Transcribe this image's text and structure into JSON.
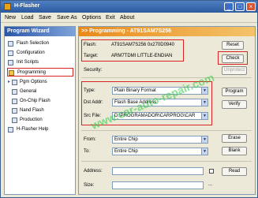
{
  "app": {
    "title": "H-Flasher"
  },
  "window_controls": {
    "minimize": "_",
    "maximize": "□",
    "close": "×"
  },
  "menu": [
    "New",
    "Load",
    "Save",
    "Save As",
    "Options",
    "Exit",
    "About"
  ],
  "sidebar": {
    "title": "Program Wizard",
    "items": [
      {
        "label": "Flash Selection",
        "arrow": ""
      },
      {
        "label": "Configuration",
        "arrow": ""
      },
      {
        "label": "Init Scripts",
        "arrow": ""
      },
      {
        "label": "Programming",
        "arrow": "",
        "active": true
      },
      {
        "label": "Pgm Options",
        "arrow": "▸"
      },
      {
        "label": "General",
        "arrow": ""
      },
      {
        "label": "On-Chip Flash",
        "arrow": ""
      },
      {
        "label": "Nand Flash",
        "arrow": ""
      },
      {
        "label": "Production",
        "arrow": ""
      },
      {
        "label": "H-Flasher Help",
        "arrow": ""
      }
    ]
  },
  "main": {
    "header": ">> Programming - AT91SAM7S256",
    "flash_label": "Flash:",
    "flash_value": "AT91SAM7S256  0x270D0940",
    "target_label": "Target:",
    "target_value": "ARM7TDMI  LITTLE-ENDIAN",
    "security_label": "Security:",
    "type_label": "Type:",
    "type_value": "Plain Binary Format",
    "dst_addr_label": "Dst Addr:",
    "dst_addr_value": "Flash Base Address",
    "src_file_label": "Src File:",
    "src_file_value": "D:\\PROGRAMADOR\\CARPROG\\CAR",
    "from_label": "From:",
    "from_value": "Entire Chip",
    "to_label": "To:",
    "to_value": "Entire Chip",
    "address_label": "Address:",
    "size_label": "Size:",
    "ellipsis": "..."
  },
  "buttons": {
    "reset": "Reset",
    "check": "Check",
    "unprotect": "Unprotect",
    "program": "Program",
    "verify": "Verify",
    "erase": "Erase",
    "blank": "Blank",
    "read": "Read"
  },
  "watermark": "www.car-auto-repair.com",
  "colors": {
    "accent_orange": "#e88a1a",
    "accent_blue": "#2d56a8",
    "highlight_red": "#d92424"
  }
}
